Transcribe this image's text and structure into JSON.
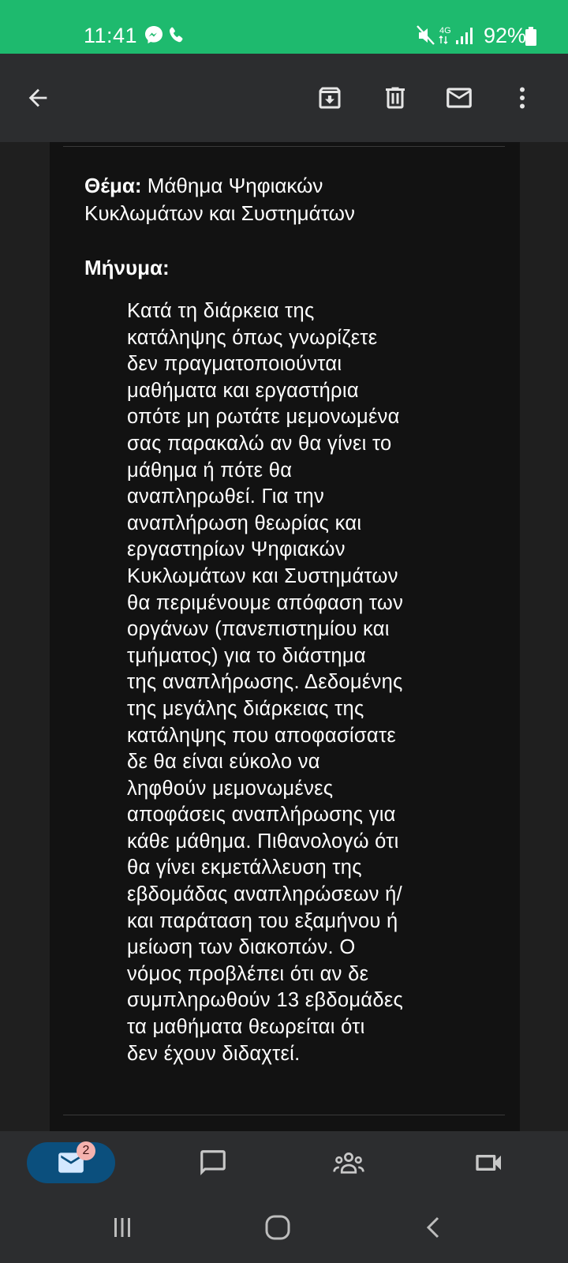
{
  "status_bar": {
    "time": "11:41",
    "battery_percent": "92%",
    "network": "4G",
    "icons": [
      "messenger-icon",
      "phone-icon",
      "mute-icon",
      "signal-icon",
      "battery-icon"
    ]
  },
  "toolbar": {
    "icons": [
      "back-arrow-icon",
      "archive-icon",
      "trash-icon",
      "mail-icon",
      "more-vert-icon"
    ]
  },
  "email": {
    "subject_label": "Θέμα:",
    "subject_text": " Μάθημα Ψηφιακών Κυκλωμάτων και Συστημάτων",
    "message_label": "Μήνυμα:",
    "body_lines": [
      "Κατά τη διάρκεια της",
      "κατάληψης όπως γνωρίζετε",
      "δεν πραγματοποιούνται",
      "μαθήματα και εργαστήρια",
      "οπότε μη ρωτάτε μεμονωμένα",
      "σας παρακαλώ αν θα γίνει το",
      "μάθημα ή πότε θα",
      "αναπληρωθεί. Για την",
      "αναπλήρωση θεωρίας και",
      "εργαστηρίων Ψηφιακών",
      "Κυκλωμάτων και Συστημάτων",
      "θα περιμένουμε απόφαση των",
      "οργάνων (πανεπιστημίου και",
      "τμήματος) για το διάστημα",
      "της αναπλήρωσης. Δεδομένης",
      "της μεγάλης διάρκειας της",
      "κατάληψης που αποφασίσατε",
      "δε θα είναι εύκολο να",
      "ληφθούν μεμονωμένες",
      "αποφάσεις αναπλήρωσης για",
      "κάθε μάθημα. Πιθανολογώ ότι",
      "θα γίνει εκμετάλλευση της",
      "εβδομάδας αναπληρώσεων ή/",
      "και παράταση του εξαμήνου ή",
      "μείωση των διακοπών. Ο",
      "νόμος προβλέπει ότι αν δε",
      "συμπληρωθούν 13 εβδομάδες",
      "τα μαθήματα θεωρείται ότι",
      "δεν έχουν διδαχτεί."
    ]
  },
  "bottom_nav": {
    "mail_badge": "2",
    "icons": [
      "mail-icon",
      "chat-icon",
      "spaces-icon",
      "meet-icon"
    ]
  },
  "system_nav": {
    "icons": [
      "recents-icon",
      "home-icon",
      "back-icon"
    ]
  },
  "colors": {
    "status_bar": "#1eba6e",
    "toolbar": "#2c2d2f",
    "background": "#1f1f1f",
    "content": "#121212",
    "active_nav": "#0b4f7d",
    "badge": "#f4b2ae"
  }
}
